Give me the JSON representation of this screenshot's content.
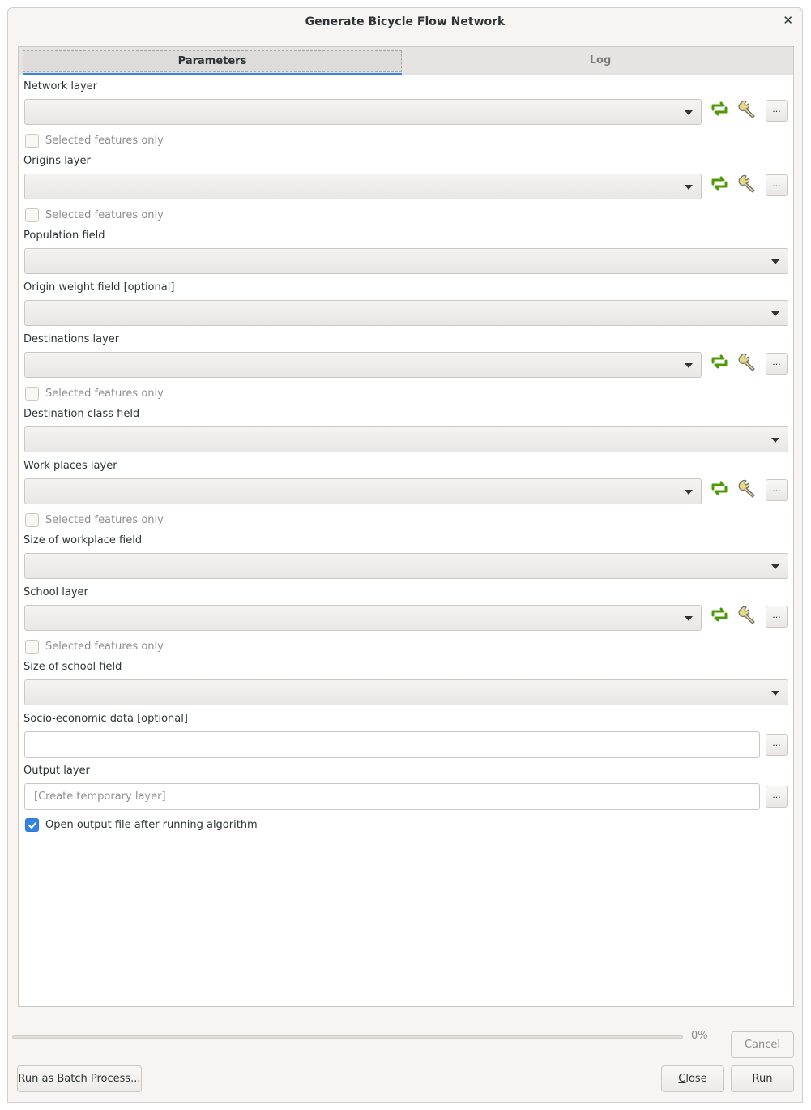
{
  "window": {
    "title": "Generate Bicycle Flow Network",
    "close_symbol": "✕"
  },
  "tabs": {
    "parameters": "Parameters",
    "log": "Log"
  },
  "params": {
    "network_layer": {
      "label": "Network layer",
      "selected_only": "Selected features only",
      "dots": "..."
    },
    "origins_layer": {
      "label": "Origins layer",
      "selected_only": "Selected features only",
      "dots": "..."
    },
    "population_field": {
      "label": "Population field"
    },
    "origin_weight_field": {
      "label": "Origin weight field [optional]"
    },
    "destinations_layer": {
      "label": "Destinations layer",
      "selected_only": "Selected features only",
      "dots": "..."
    },
    "destination_class_field": {
      "label": "Destination class field"
    },
    "work_places_layer": {
      "label": "Work places layer",
      "selected_only": "Selected features only",
      "dots": "..."
    },
    "size_of_workplace_field": {
      "label": "Size of workplace field"
    },
    "school_layer": {
      "label": "School layer",
      "selected_only": "Selected features only",
      "dots": "..."
    },
    "size_of_school_field": {
      "label": "Size of school field"
    },
    "socio_economic": {
      "label": "Socio-economic data [optional]",
      "value": "",
      "dots": "..."
    },
    "output_layer": {
      "label": "Output layer",
      "placeholder": "[Create temporary layer]",
      "dots": "..."
    },
    "open_output": {
      "label": "Open output file after running algorithm",
      "checked": true
    }
  },
  "progress": {
    "value": 0,
    "text": "0%"
  },
  "buttons": {
    "cancel": "Cancel",
    "batch": "Run as Batch Process...",
    "close_prefix": "C",
    "close_rest": "lose",
    "run": "Run"
  },
  "icons": {
    "refresh": "iterate-features-icon",
    "wrench": "advanced-options-wrench-icon",
    "accent": "#3584e4",
    "refresh_color": "#4e9a06"
  }
}
